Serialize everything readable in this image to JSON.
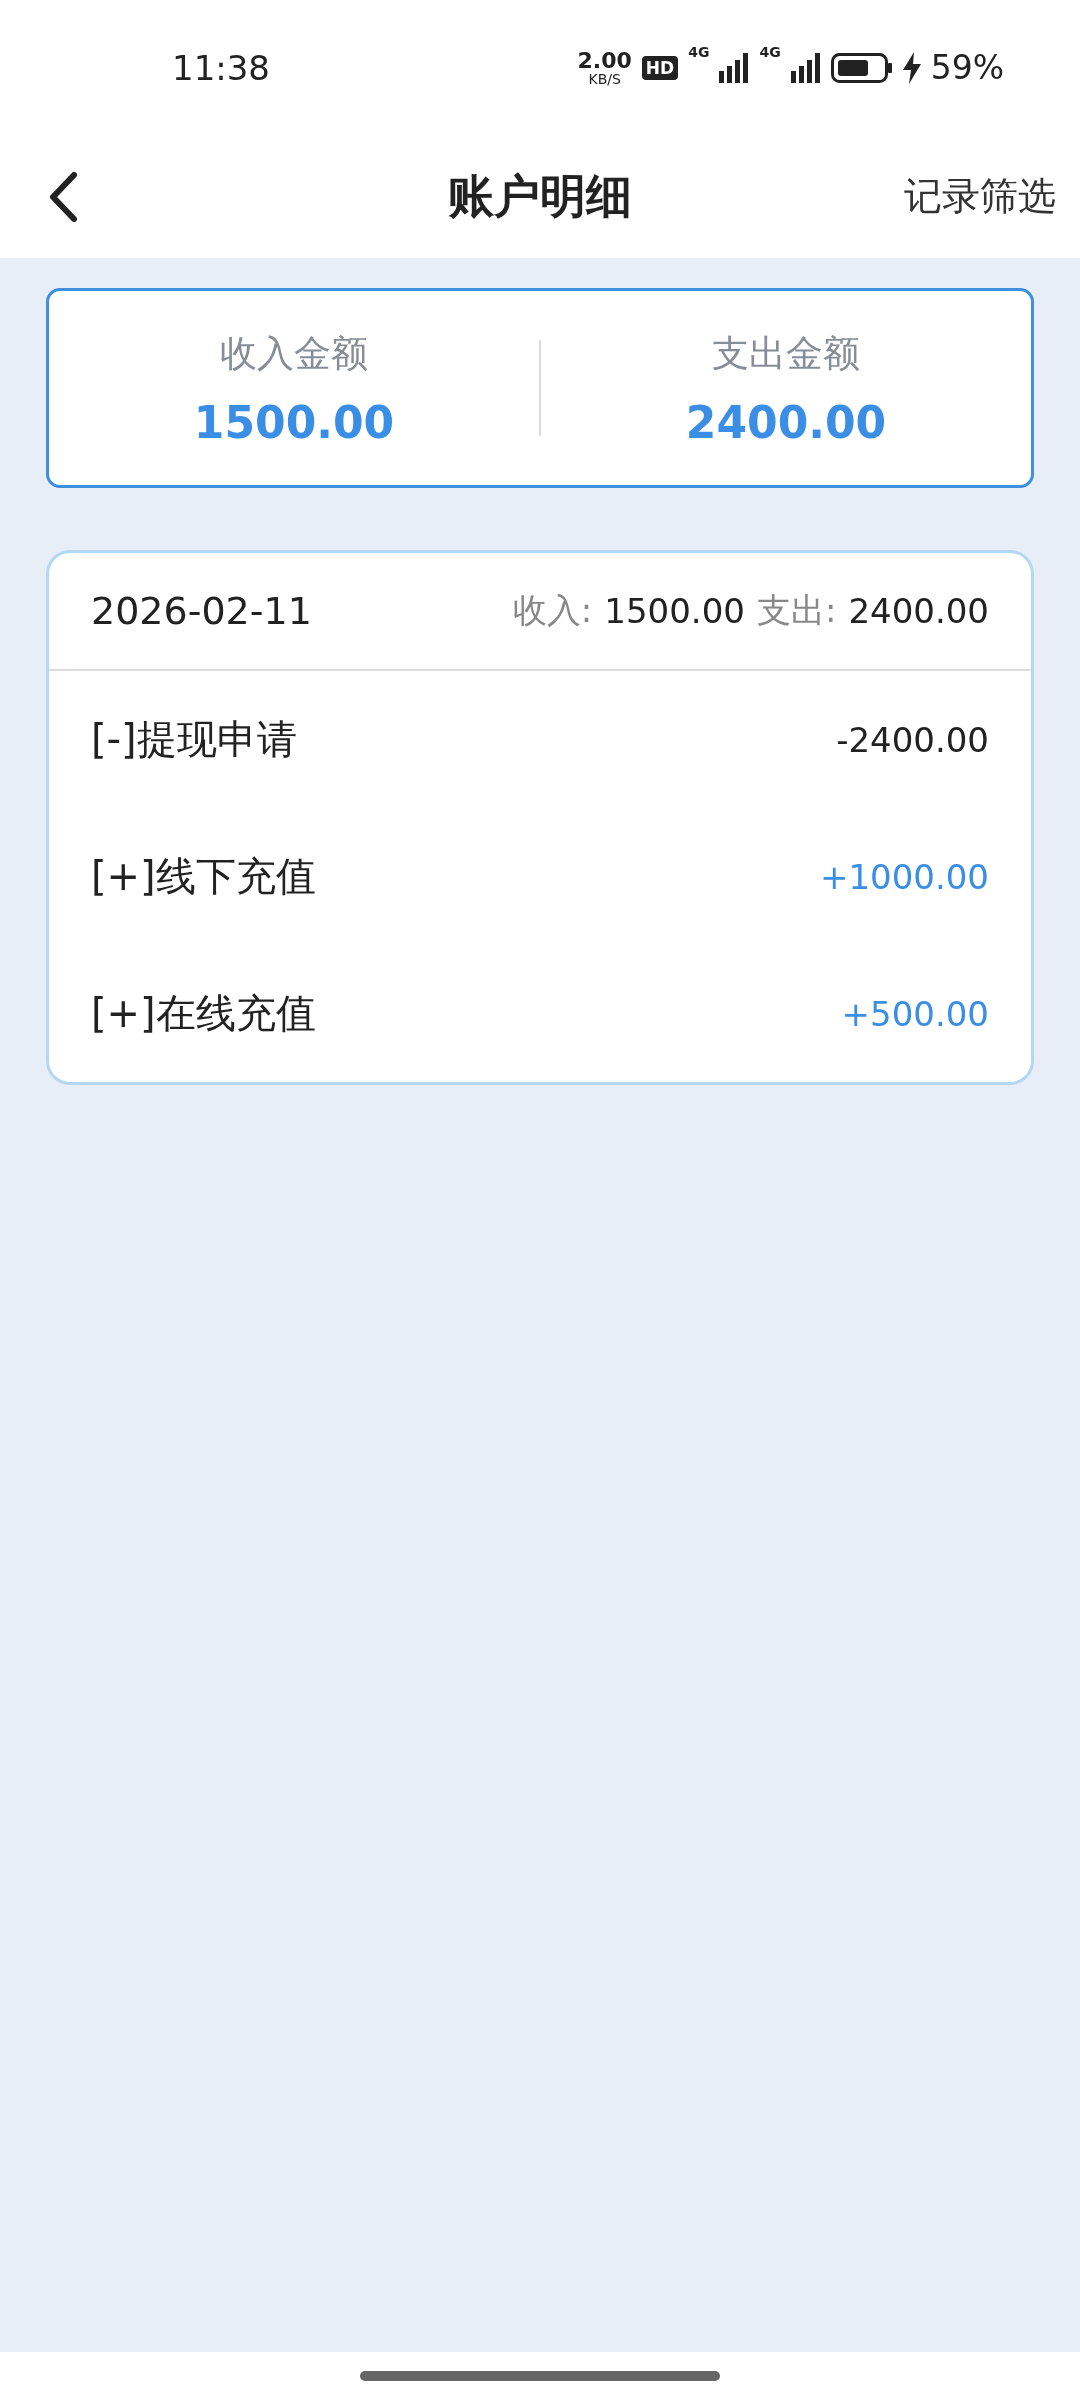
{
  "status_bar": {
    "time": "11:38",
    "net_speed": "2.00",
    "net_unit": "KB/S",
    "hd_badge": "HD",
    "signal_labels": [
      "4G",
      "4G"
    ],
    "battery": "59%"
  },
  "header": {
    "title": "账户明细",
    "action": "记录筛选"
  },
  "summary": [
    {
      "label": "收入金额",
      "amount": "1500.00"
    },
    {
      "label": "支出金额",
      "amount": "2400.00"
    }
  ],
  "day_group": {
    "date": "2026-02-11",
    "income_label": "收入:",
    "income": "1500.00",
    "expense_label": "支出:",
    "expense": "2400.00",
    "rows": [
      {
        "title": "[-]提现申请",
        "amount": "-2400.00",
        "kind": "expense"
      },
      {
        "title": "[+]线下充值",
        "amount": "+1000.00",
        "kind": "income"
      },
      {
        "title": "[+]在线充值",
        "amount": "+500.00",
        "kind": "income"
      }
    ]
  }
}
